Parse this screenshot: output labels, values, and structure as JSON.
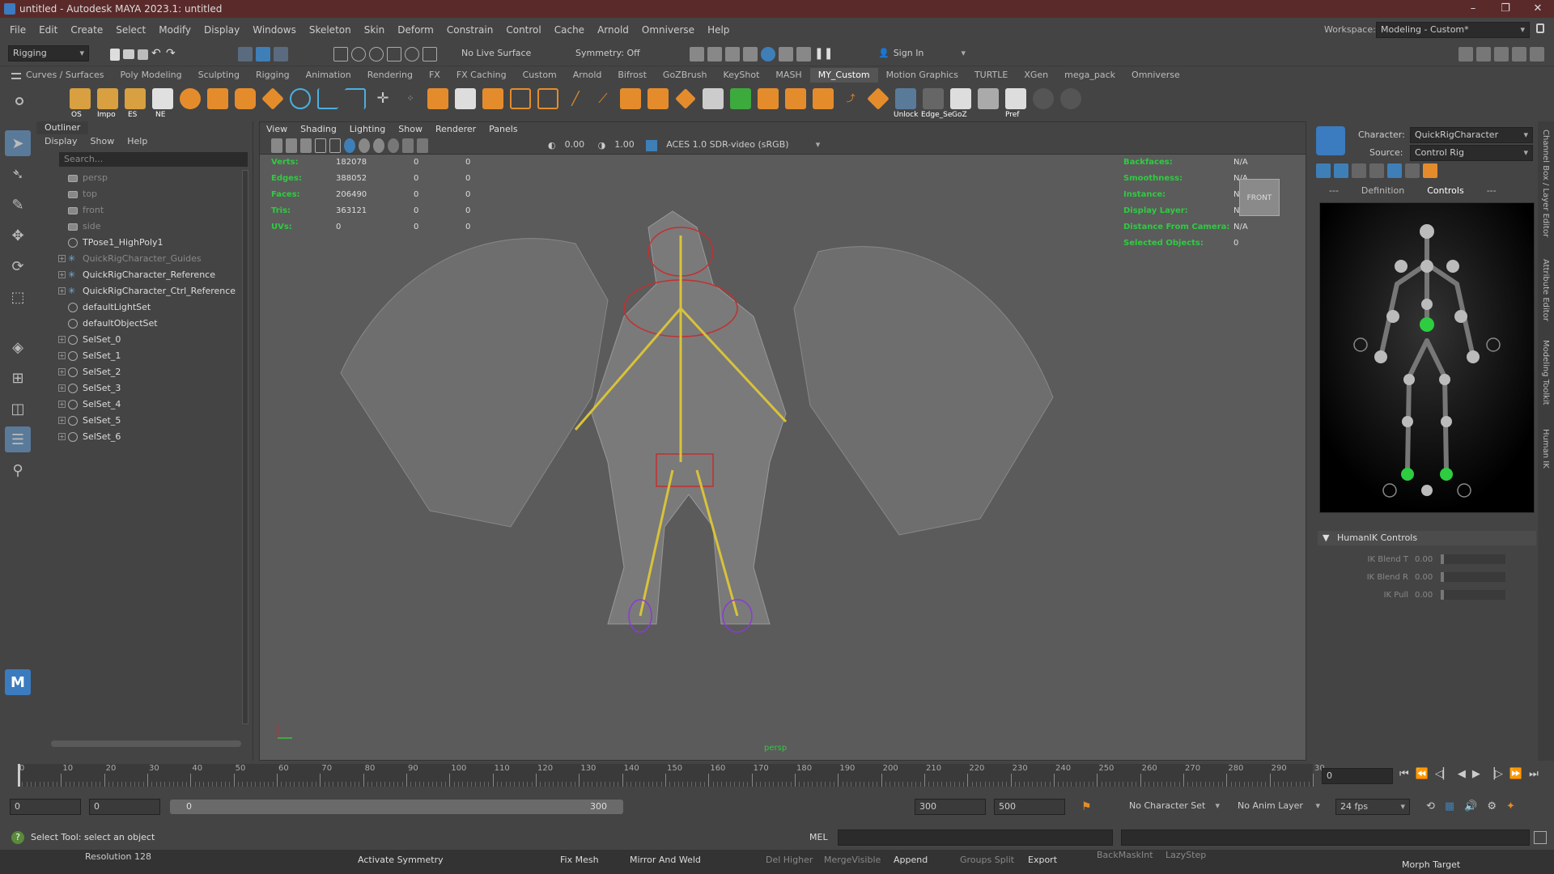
{
  "window": {
    "title": "untitled - Autodesk MAYA 2023.1: untitled"
  },
  "menubar": {
    "items": [
      "File",
      "Edit",
      "Create",
      "Select",
      "Modify",
      "Display",
      "Windows",
      "Skeleton",
      "Skin",
      "Deform",
      "Constrain",
      "Control",
      "Cache",
      "Arnold",
      "Omniverse",
      "Help"
    ],
    "workspace_label": "Workspace:",
    "workspace_value": "Modeling - Custom*"
  },
  "statusline": {
    "menuset": "Rigging",
    "live_surface": "No Live Surface",
    "symmetry": "Symmetry: Off",
    "sign_in": "Sign In"
  },
  "shelf": {
    "tabs": [
      "Curves / Surfaces",
      "Poly Modeling",
      "Sculpting",
      "Rigging",
      "Animation",
      "Rendering",
      "FX",
      "FX Caching",
      "Custom",
      "Arnold",
      "Bifrost",
      "GoZBrush",
      "KeyShot",
      "MASH",
      "MY_Custom",
      "Motion Graphics",
      "TURTLE",
      "XGen",
      "mega_pack",
      "Omniverse"
    ],
    "active_tab": "MY_Custom",
    "labels": [
      "OS",
      "Impo",
      "ES",
      "NE",
      "Unlock",
      "Edge_Se",
      "GoZ",
      "Pref"
    ]
  },
  "outliner": {
    "title": "Outliner",
    "menu": [
      "Display",
      "Show",
      "Help"
    ],
    "search_placeholder": "Search...",
    "items": [
      "persp",
      "top",
      "front",
      "side",
      "TPose1_HighPoly1",
      "QuickRigCharacter_Guides",
      "QuickRigCharacter_Reference",
      "QuickRigCharacter_Ctrl_Reference",
      "defaultLightSet",
      "defaultObjectSet",
      "SelSet_0",
      "SelSet_1",
      "SelSet_2",
      "SelSet_3",
      "SelSet_4",
      "SelSet_5",
      "SelSet_6"
    ]
  },
  "viewport": {
    "menu": [
      "View",
      "Shading",
      "Lighting",
      "Show",
      "Renderer",
      "Panels"
    ],
    "exposure": "0.00",
    "gamma": "1.00",
    "colorspace": "ACES 1.0 SDR-video (sRGB)",
    "camera_label": "persp",
    "viewcube_label": "FRONT",
    "stats": [
      {
        "label": "Verts:",
        "v1": "182078",
        "v2": "0",
        "v3": "0"
      },
      {
        "label": "Edges:",
        "v1": "388052",
        "v2": "0",
        "v3": "0"
      },
      {
        "label": "Faces:",
        "v1": "206490",
        "v2": "0",
        "v3": "0"
      },
      {
        "label": "Tris:",
        "v1": "363121",
        "v2": "0",
        "v3": "0"
      },
      {
        "label": "UVs:",
        "v1": "0",
        "v2": "0",
        "v3": "0"
      }
    ],
    "info": [
      {
        "label": "Backfaces:",
        "value": "N/A"
      },
      {
        "label": "Smoothness:",
        "value": "N/A"
      },
      {
        "label": "Instance:",
        "value": "N/A"
      },
      {
        "label": "Display Layer:",
        "value": "N/A"
      },
      {
        "label": "Distance From Camera:",
        "value": "N/A"
      },
      {
        "label": "Selected Objects:",
        "value": "0"
      }
    ]
  },
  "humanik": {
    "character_label": "Character:",
    "character_value": "QuickRigCharacter",
    "source_label": "Source:",
    "source_value": "Control Rig",
    "tabs": [
      "---",
      "Definition",
      "Controls",
      "---"
    ],
    "controls_title": "HumanIK Controls",
    "sliders": [
      {
        "label": "IK Blend T",
        "value": "0.00"
      },
      {
        "label": "IK Blend R",
        "value": "0.00"
      },
      {
        "label": "IK Pull",
        "value": "0.00"
      }
    ]
  },
  "sidetabs": [
    "Channel Box / Layer Editor",
    "Attribute Editor",
    "Modeling Toolkit",
    "Human IK"
  ],
  "timeline": {
    "ticks": [
      "0",
      "10",
      "20",
      "30",
      "40",
      "50",
      "60",
      "70",
      "80",
      "90",
      "100",
      "110",
      "120",
      "130",
      "140",
      "150",
      "160",
      "170",
      "180",
      "190",
      "200",
      "210",
      "220",
      "230",
      "240",
      "250",
      "260",
      "270",
      "280",
      "290",
      "30"
    ],
    "current_frame": "0"
  },
  "range": {
    "start": "0",
    "playback_start": "0",
    "slider_start": "0",
    "slider_end": "300",
    "playback_end": "300",
    "end": "500",
    "character_set": "No Character Set",
    "anim_layer": "No Anim Layer",
    "fps": "24 fps"
  },
  "cmdline": {
    "help": "Select Tool: select an object",
    "lang": "MEL"
  },
  "bottom_shelf": {
    "items": [
      "Resolution 128",
      "Activate Symmetry",
      "Fix Mesh",
      "Mirror And Weld",
      "Del Higher",
      "MergeVisible",
      "Append",
      "Groups Split",
      "Export",
      "BackMaskInt",
      "LazyStep",
      "Morph Target"
    ]
  }
}
